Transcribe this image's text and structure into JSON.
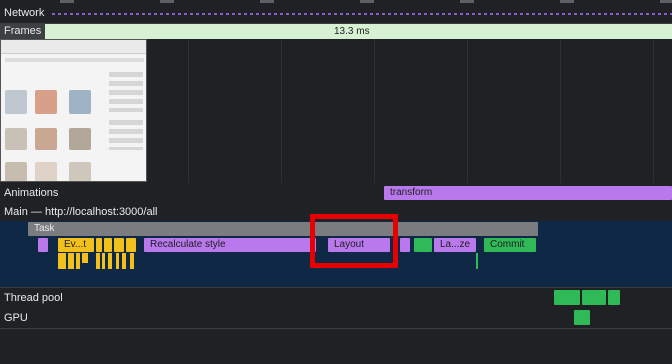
{
  "tracks": {
    "network": "Network",
    "frames": "Frames",
    "frame_duration": "13.3 ms",
    "animations": "Animations",
    "main": "Main — http://localhost:3000/all",
    "thread_pool": "Thread pool",
    "gpu": "GPU"
  },
  "events": {
    "animation_transform": "transform",
    "task": "Task",
    "event_short": "Ev...t",
    "recalc_style": "Recalculate style",
    "layout": "Layout",
    "lazy_short": "La...ze",
    "commit": "Commit"
  },
  "colors": {
    "background": "#202124",
    "main_track": "#0e2846",
    "frame_bar": "#d7f2d2",
    "rendering_purple": "#b978ec",
    "painting_green": "#2fb957",
    "scripting_yellow": "#f2c01c",
    "task_grey": "#7b7c7f",
    "highlight_red": "#e60000"
  }
}
